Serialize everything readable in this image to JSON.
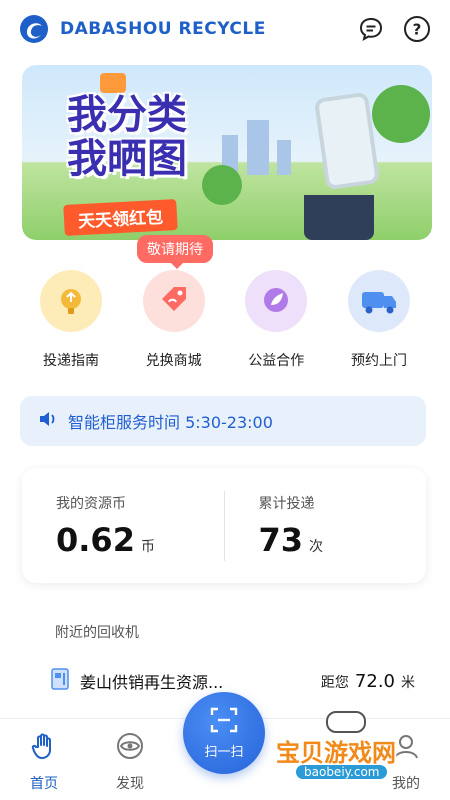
{
  "header": {
    "brand": "DABASHOU RECYCLE",
    "logo_icon": "swirl-logo-icon",
    "actions": [
      {
        "name": "message-icon"
      },
      {
        "name": "help-icon"
      }
    ]
  },
  "banner": {
    "line1": "我分类",
    "line2": "我晒图",
    "sub": "天天领红包"
  },
  "badge": {
    "text": "敬请期待"
  },
  "quick_menu": [
    {
      "label": "投递指南",
      "icon": "guide-icon",
      "bg": "#fdebb8"
    },
    {
      "label": "兑换商城",
      "icon": "shop-tag-icon",
      "bg": "#fde0dc"
    },
    {
      "label": "公益合作",
      "icon": "charity-icon",
      "bg": "#eee0fa"
    },
    {
      "label": "预约上门",
      "icon": "truck-icon",
      "bg": "#dde9fb"
    }
  ],
  "notice": {
    "text": "智能柜服务时间 5:30-23:00",
    "icon": "speaker-icon"
  },
  "stats": {
    "coins": {
      "label": "我的资源币",
      "value": "0.62",
      "unit": "币"
    },
    "deliveries": {
      "label": "累计投递",
      "value": "73",
      "unit": "次"
    }
  },
  "nearby": {
    "title": "附近的回收机",
    "machine": {
      "name": "姜山供销再生资源...",
      "distance_prefix": "距您",
      "distance": "72.0",
      "unit": "米"
    }
  },
  "tabbar": {
    "tabs": [
      {
        "label": "首页",
        "icon": "hand-icon",
        "active": true
      },
      {
        "label": "发现",
        "icon": "eye-icon",
        "active": false
      },
      {
        "label": "我的",
        "icon": "profile-icon",
        "active": false
      }
    ],
    "scan_label": "扫一扫"
  },
  "watermark": {
    "title": "宝贝游戏网",
    "url": "baobeiy.com"
  },
  "colors": {
    "brand": "#1e5fc8",
    "accent": "#ff6a63",
    "notice_bg": "#e8f0fc"
  }
}
